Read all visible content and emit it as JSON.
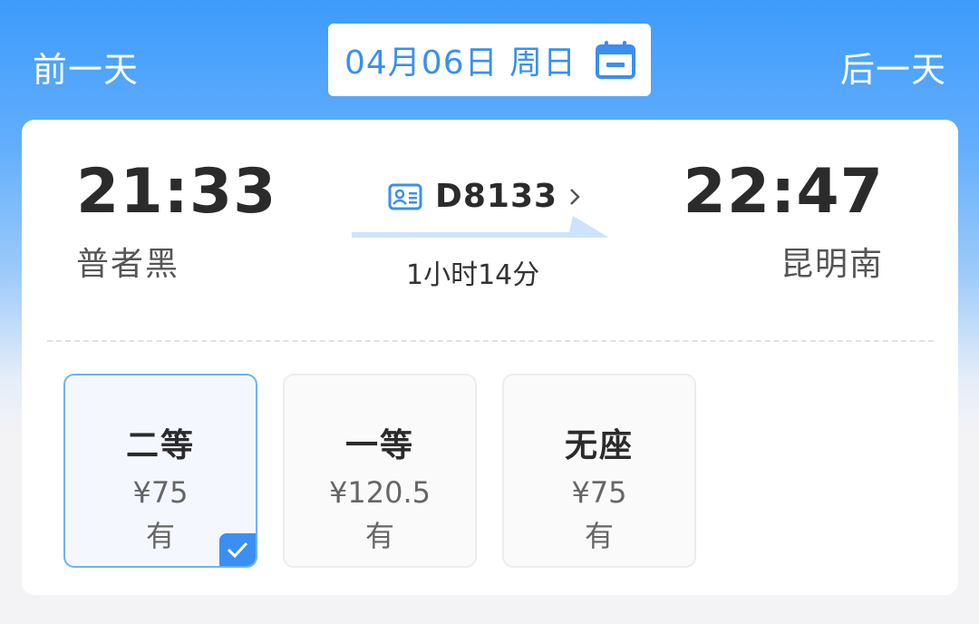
{
  "header": {
    "prev_day": "前一天",
    "next_day": "后一天",
    "date": "04月06日  周日",
    "calendar_icon": "calendar-icon"
  },
  "trip": {
    "departure_time": "21:33",
    "departure_station": "普者黑",
    "arrival_time": "22:47",
    "arrival_station": "昆明南",
    "train_number": "D8133",
    "duration": "1小时14分",
    "train_icon": "ticket-card-icon",
    "chevron_icon": "chevron-right-icon",
    "arrow_icon": "direction-arrow-icon"
  },
  "seats": [
    {
      "name": "二等",
      "price": "¥75",
      "availability": "有",
      "selected": true
    },
    {
      "name": "一等",
      "price": "¥120.5",
      "availability": "有",
      "selected": false
    },
    {
      "name": "无座",
      "price": "¥75",
      "availability": "有",
      "selected": false
    }
  ],
  "colors": {
    "accent": "#3a8ff0",
    "header_top": "#3d9bfb",
    "selected_border": "#6eb2f5",
    "text_primary": "#2b2b2b"
  }
}
